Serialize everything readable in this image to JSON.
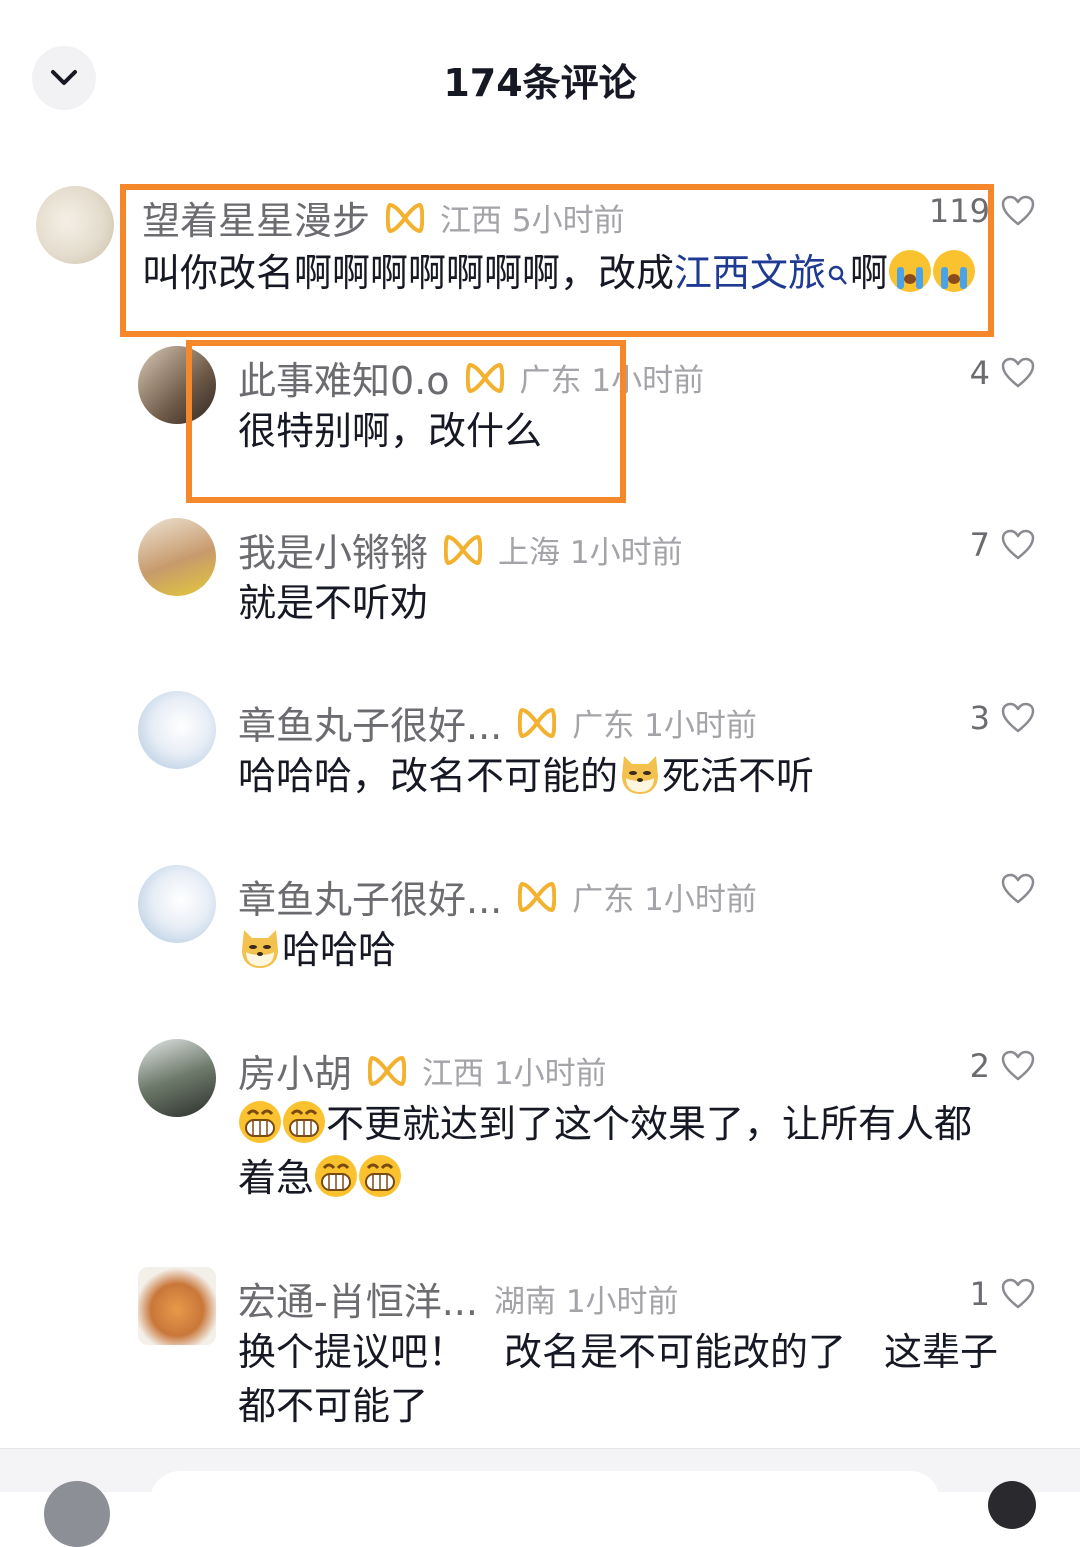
{
  "header": {
    "title": "174条评论"
  },
  "comments": [
    {
      "name": "望着星星漫步",
      "location": "江西",
      "time": "5小时前",
      "likes": "119",
      "text_a": "叫你改名啊啊啊啊啊啊啊，改成",
      "keyword": "江西文旅",
      "text_b": "啊",
      "emojis": [
        "crying-emoji",
        "crying-emoji"
      ]
    },
    {
      "name": "此事难知0.o",
      "location": "广东",
      "time": "1小时前",
      "likes": "4",
      "text": "很特别啊，改什么"
    },
    {
      "name": "我是小锵锵",
      "location": "上海",
      "time": "1小时前",
      "likes": "7",
      "text": "就是不听劝"
    },
    {
      "name": "章鱼丸子很好...",
      "location": "广东",
      "time": "1小时前",
      "likes": "3",
      "text_a": "哈哈哈，改名不可能的",
      "text_b": "死活不听",
      "emojis": [
        "doge-emoji"
      ]
    },
    {
      "name": "章鱼丸子很好...",
      "location": "广东",
      "time": "1小时前",
      "likes": "",
      "text": "哈哈哈",
      "emojis": [
        "doge-emoji"
      ]
    },
    {
      "name": "房小胡",
      "location": "江西",
      "time": "1小时前",
      "likes": "2",
      "line1": "不更就达到了这个效果了，让所有人都",
      "line2": "着急",
      "emojis": [
        "grin-emoji",
        "grin-emoji",
        "grin-emoji",
        "grin-emoji"
      ]
    },
    {
      "name": "宏通-肖恒洋...",
      "location": "湖南",
      "time": "1小时前",
      "likes": "1",
      "line1": "换个提议吧！　改名是不可能改的了　这辈子",
      "line2": "都不可能了"
    }
  ],
  "colors": {
    "highlight": "#f5882a",
    "keyword": "#1f3a93",
    "badge": "#f2b230"
  },
  "icons": [
    "chevron-down-icon",
    "heart-outline-icon",
    "fan-badge-icon",
    "search-icon"
  ]
}
